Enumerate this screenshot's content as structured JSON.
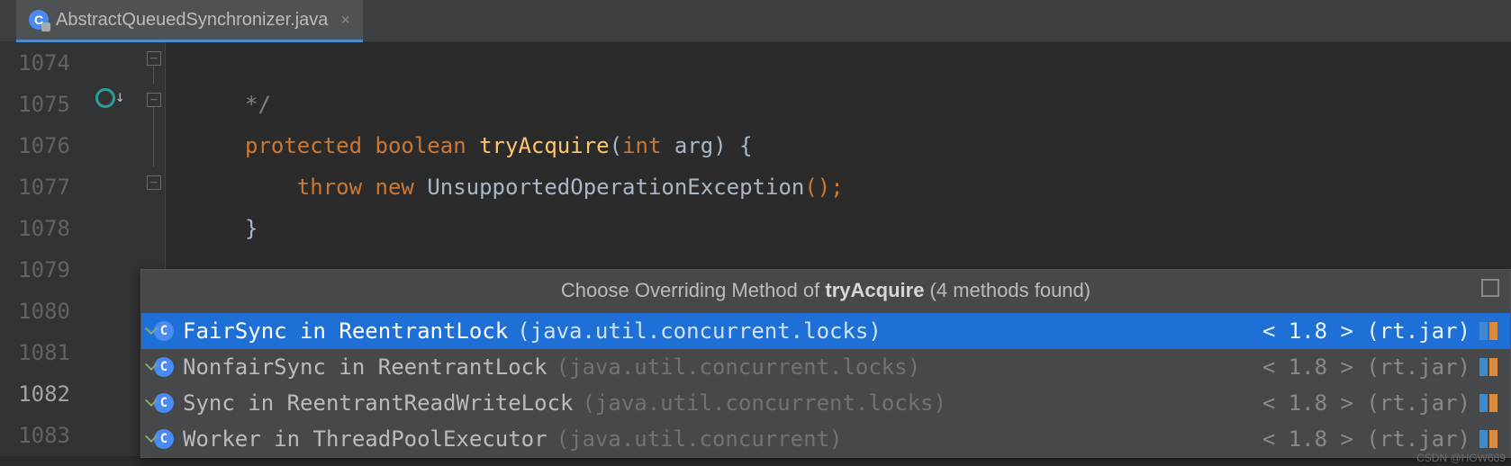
{
  "tab": {
    "filename": "AbstractQueuedSynchronizer.java"
  },
  "gutter": {
    "lines": [
      "1074",
      "1075",
      "1076",
      "1077",
      "1078",
      "1079",
      "1080",
      "1081",
      "1082",
      "1083"
    ],
    "current_line": "1082"
  },
  "code": {
    "l1074": "*/",
    "l1075": {
      "kw_protected": "protected",
      "kw_boolean": "boolean",
      "method": "tryAcquire",
      "paren_open": "(",
      "kw_int": "int",
      "param": " arg",
      "paren_close_brace": ") {"
    },
    "l1076": {
      "kw_throw": "throw",
      "kw_new": "new",
      "type": "UnsupportedOperationException",
      "tail": "();"
    },
    "l1077": "}"
  },
  "popup": {
    "title_prefix": "Choose Overriding Method of ",
    "title_method": "tryAcquire",
    "title_suffix": " (4 methods found)",
    "rows": [
      {
        "main": "FairSync in ReentrantLock",
        "pkg": "(java.util.concurrent.locks)",
        "meta": "< 1.8 > (rt.jar)",
        "selected": true
      },
      {
        "main": "NonfairSync in ReentrantLock",
        "pkg": "(java.util.concurrent.locks)",
        "meta": "< 1.8 > (rt.jar)",
        "selected": false
      },
      {
        "main": "Sync in ReentrantReadWriteLock",
        "pkg": "(java.util.concurrent.locks)",
        "meta": "< 1.8 > (rt.jar)",
        "selected": false
      },
      {
        "main": "Worker in ThreadPoolExecutor",
        "pkg": "(java.util.concurrent)",
        "meta": "< 1.8 > (rt.jar)",
        "selected": false
      }
    ]
  },
  "watermark": "CSDN @HGW689"
}
